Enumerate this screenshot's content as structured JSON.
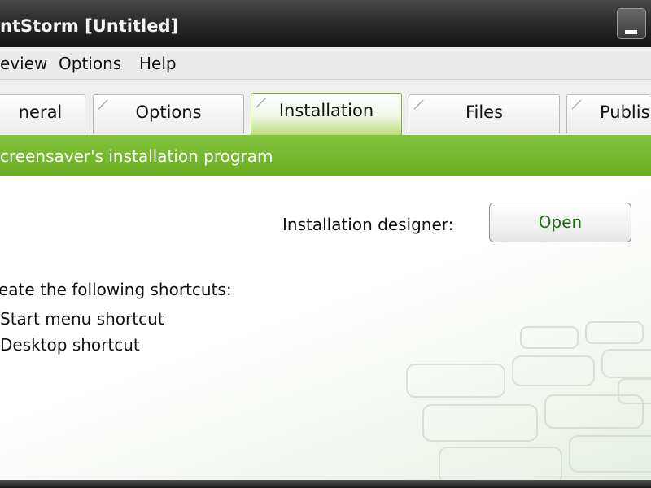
{
  "window": {
    "title": "ntStorm [Untitled]"
  },
  "menu": {
    "items": [
      {
        "label": "eview"
      },
      {
        "label": "Options"
      },
      {
        "label": "Help"
      }
    ]
  },
  "tabs": [
    {
      "label": "neral",
      "active": false
    },
    {
      "label": "Options",
      "active": false
    },
    {
      "label": "Installation",
      "active": true
    },
    {
      "label": "Files",
      "active": false
    },
    {
      "label": "Publish",
      "active": false
    }
  ],
  "banner": {
    "text": "creensaver's installation program"
  },
  "installation": {
    "designer_label": "Installation designer:",
    "open_button": "Open",
    "shortcuts_heading": "eate the following shortcuts:",
    "shortcuts": [
      {
        "label": "Start menu shortcut"
      },
      {
        "label": "Desktop shortcut"
      }
    ]
  },
  "colors": {
    "accent_green": "#78b930",
    "button_text": "#1c6e15",
    "titlebar": "#222222"
  }
}
